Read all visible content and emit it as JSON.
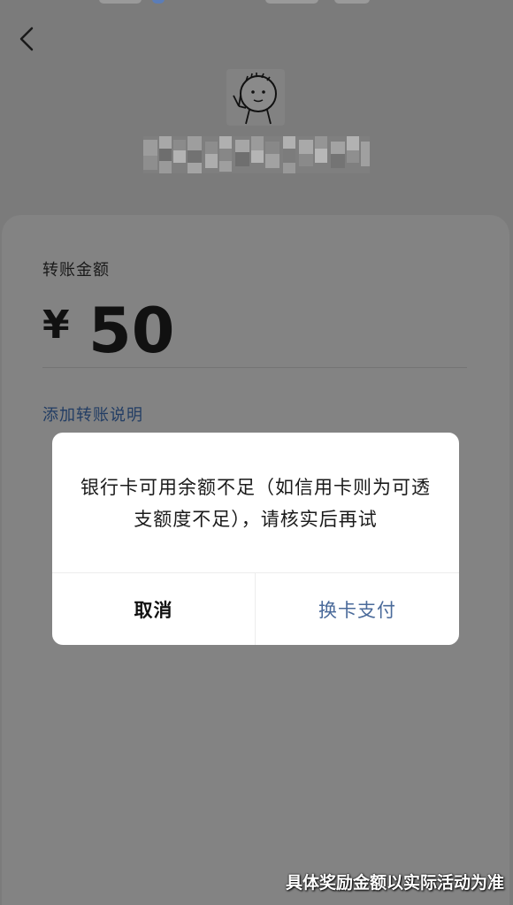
{
  "payment": {
    "amount_label": "转账金额",
    "currency_symbol": "¥",
    "amount": "50",
    "add_note_label": "添加转账说明"
  },
  "dialog": {
    "message": "银行卡可用余额不足（如信用卡则为可透支额度不足），请核实后再试",
    "cancel_label": "取消",
    "switch_card_label": "换卡支付"
  },
  "watermark": "具体奖励金额以实际活动为准",
  "icons": {
    "back": "chevron-left-icon",
    "avatar": "cartoon-avatar"
  },
  "colors": {
    "overlay_bg": "#7b7b7b",
    "link": "#223d64",
    "dialog_action": "#4a6a9a",
    "dialog_bg": "#ffffff"
  }
}
